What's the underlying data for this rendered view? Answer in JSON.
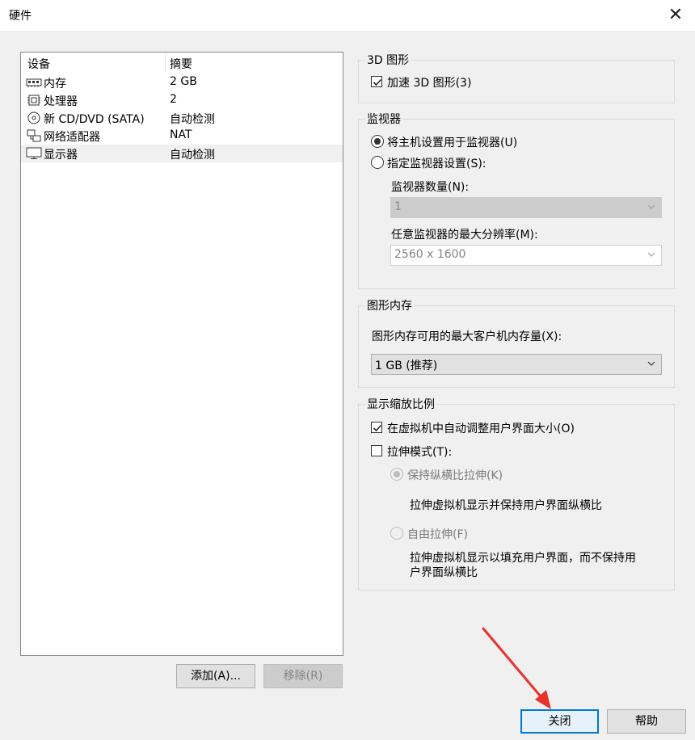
{
  "window": {
    "title": "硬件",
    "close_glyph": "✕"
  },
  "device_list": {
    "col_device": "设备",
    "col_summary": "摘要",
    "rows": [
      {
        "name": "内存",
        "summary": "2 GB",
        "icon": "memory-icon"
      },
      {
        "name": "处理器",
        "summary": "2",
        "icon": "cpu-icon"
      },
      {
        "name": "新 CD/DVD (SATA)",
        "summary": "自动检测",
        "icon": "cd-dvd-icon"
      },
      {
        "name": "网络适配器",
        "summary": "NAT",
        "icon": "network-icon"
      },
      {
        "name": "显示器",
        "summary": "自动检测",
        "icon": "monitor-icon",
        "selected": true
      }
    ],
    "add_button": "添加(A)...",
    "remove_button": "移除(R)"
  },
  "graphics3d": {
    "legend": "3D 图形",
    "accelerate_label": "加速 3D 图形(3)",
    "accelerate_checked": true
  },
  "monitors": {
    "legend": "监视器",
    "use_host_label": "将主机设置用于监视器(U)",
    "use_host_selected": true,
    "specify_label": "指定监视器设置(S):",
    "count_label": "监视器数量(N):",
    "count_value": "1",
    "max_res_label": "任意监视器的最大分辨率(M):",
    "max_res_value": "2560 x 1600"
  },
  "graphics_memory": {
    "legend": "图形内存",
    "label": "图形内存可用的最大客户机内存量(X):",
    "value": "1 GB (推荐)"
  },
  "display_scaling": {
    "legend": "显示缩放比例",
    "auto_adjust_label": "在虚拟机中自动调整用户界面大小(O)",
    "auto_adjust_checked": true,
    "stretch_label": "拉伸模式(T):",
    "stretch_checked": false,
    "keep_aspect_label": "保持纵横比拉伸(K)",
    "keep_aspect_desc": "拉伸虚拟机显示并保持用户界面纵横比",
    "free_stretch_label": "自由拉伸(F)",
    "free_stretch_desc_line1": "拉伸虚拟机显示以填充用户界面，而不保持用",
    "free_stretch_desc_line2": "户界面纵横比"
  },
  "footer": {
    "close_button": "关闭",
    "help_button": "帮助"
  },
  "colors": {
    "accent": "#0078d7",
    "annotation_arrow": "#e8322c",
    "window_bg": "#f0f0f0"
  }
}
